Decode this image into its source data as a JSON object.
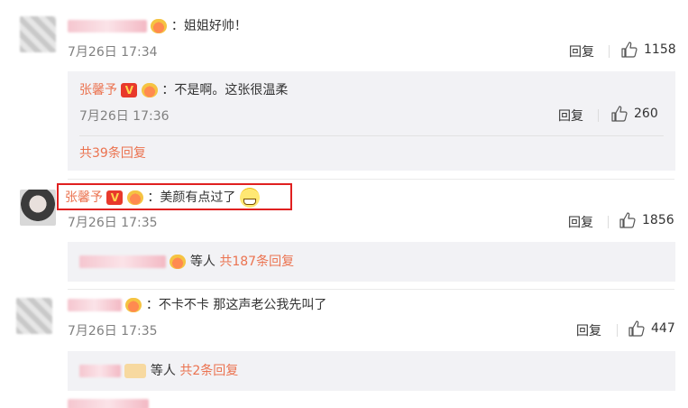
{
  "comments": [
    {
      "text": "：姐姐好帅！",
      "time": "7月26日 17:34",
      "reply_label": "回复",
      "likes": "1158",
      "sub_replies": [
        {
          "user": "张馨予",
          "verified_badge": "V",
          "text": "：不是啊。这张很温柔",
          "time": "7月26日 17:36",
          "reply_label": "回复",
          "likes": "260"
        }
      ],
      "more_replies": "共39条回复"
    },
    {
      "user": "张馨予",
      "verified_badge": "V",
      "text": "：美颜有点过了",
      "time": "7月26日 17:35",
      "reply_label": "回复",
      "likes": "1856",
      "summary_label": "等人",
      "more_replies": "共187条回复"
    },
    {
      "text": "：不卡不卡 那这声老公我先叫了",
      "time": "7月26日 17:35",
      "reply_label": "回复",
      "likes": "447",
      "summary_label": "等人",
      "more_replies": "共2条回复"
    }
  ],
  "colors": {
    "accent": "#eb7350",
    "highlight_border": "#e02020",
    "subreply_bg": "#f2f2f5",
    "time_text": "#808080"
  },
  "icons": [
    "thumb-up-icon",
    "verified-v-icon",
    "crown-badge-icon",
    "grin-emoji-icon"
  ]
}
